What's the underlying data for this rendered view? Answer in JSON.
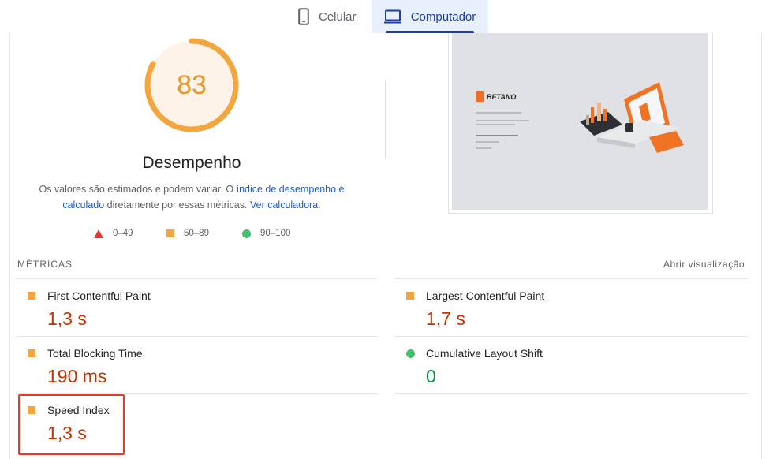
{
  "tabs": [
    {
      "label": "Celular",
      "icon": "phone-icon",
      "active": false
    },
    {
      "label": "Computador",
      "icon": "laptop-icon",
      "active": true
    }
  ],
  "score": {
    "value": "83",
    "fraction": 0.83,
    "color": "#f3a53e"
  },
  "title": "Desempenho",
  "description": {
    "part1": "Os valores são estimados e podem variar. O ",
    "link1": "índice de desempenho é calculado",
    "part2": " diretamente por essas métricas. ",
    "link2": "Ver calculadora."
  },
  "legend": [
    {
      "label": "0–49",
      "shape": "triangle",
      "color": "#e8362c"
    },
    {
      "label": "50–89",
      "shape": "square",
      "color": "#f3a53e"
    },
    {
      "label": "90–100",
      "shape": "circle",
      "color": "#3fc36b"
    }
  ],
  "thumbnail": {
    "brand": "BETANO"
  },
  "metrics_header": {
    "label": "MÉTRICAS",
    "toggle": "Abrir visualização"
  },
  "metrics": [
    {
      "name": "First Contentful Paint",
      "value": "1,3 s",
      "status": "average"
    },
    {
      "name": "Largest Contentful Paint",
      "value": "1,7 s",
      "status": "average"
    },
    {
      "name": "Total Blocking Time",
      "value": "190 ms",
      "status": "average"
    },
    {
      "name": "Cumulative Layout Shift",
      "value": "0",
      "status": "pass"
    },
    {
      "name": "Speed Index",
      "value": "1,3 s",
      "status": "average"
    }
  ]
}
